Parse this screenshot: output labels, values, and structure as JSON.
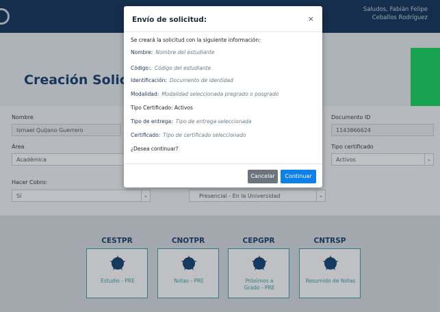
{
  "header": {
    "greeting_line1": "Saludos, Fabián Felipe",
    "greeting_line2": "Ceballos Rodríguez"
  },
  "page": {
    "title": "Creación Solicitud"
  },
  "form": {
    "nombre_label": "Nombre",
    "nombre_value": "Ismael Quijano Guerrero",
    "documento_label": "Documento ID",
    "documento_value": "1143866624",
    "area_label": "Área",
    "area_value": "Académica",
    "tipo_cert_label": "Tipo certificado",
    "tipo_cert_value": "Activos",
    "hacer_cobro_label": "Hacer Cobro:",
    "hacer_cobro_value": "Sí",
    "entrega_value": "Presencial - En la Universidad"
  },
  "cards": [
    {
      "code": "CESTPR",
      "label": "Estudio - PRE"
    },
    {
      "code": "CNOTPR",
      "label": "Notas - PRE"
    },
    {
      "code": "CEPGPR",
      "label": "Próximos a Grado - PRE"
    },
    {
      "code": "CNTRSP",
      "label": "Resumido de Notas"
    }
  ],
  "modal": {
    "title": "Envío de solicitud:",
    "intro": "Se creará la solicitud con la siguiente información:",
    "nombre_key": "Nombre:",
    "nombre_val": "Nombre del estudiante",
    "codigo_key": "Código:.",
    "codigo_val": "Código del estudiante",
    "ident_key": "Identificación:",
    "ident_val": "Documento de identidad",
    "modalidad_key": "Modalidad:",
    "modalidad_val": "Modalidad seleccionada pregrado o posgrado",
    "tipo_cert": "Tipo Certificado: Activos",
    "entrega_key": "Tipo de entrega:",
    "entrega_val": "Tipo de entrega seleccionada",
    "cert_key": "Certificado:",
    "cert_val": "Tipo de certificado seleccionado",
    "question": "¿Desea continuar?",
    "cancel_label": "Cancelar",
    "continue_label": "Continuar"
  },
  "colors": {
    "header_bg": "#0f2f57",
    "title_color": "#123a6d",
    "accent_green": "#14d45a",
    "primary_button": "#0d7fe6",
    "secondary_button": "#6c757d",
    "card_border": "#2fa1a8"
  }
}
